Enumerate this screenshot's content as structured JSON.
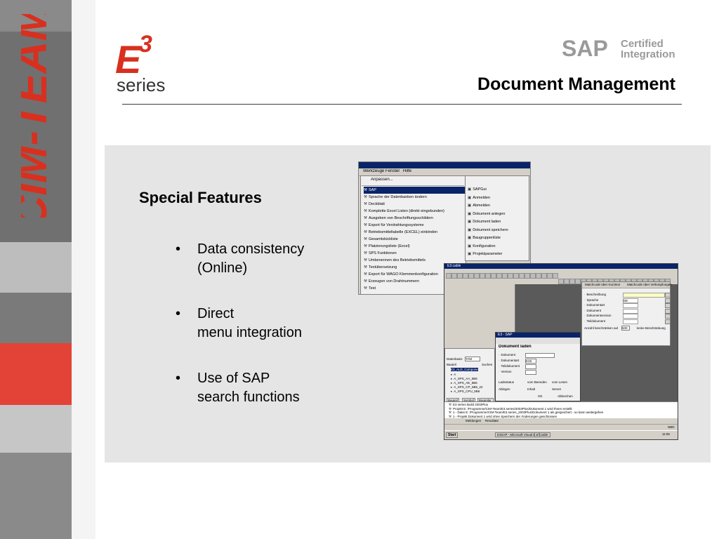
{
  "brand": {
    "sidebar_text": "CIM-TEAM",
    "logo_text": "series",
    "logo_mark": "E3",
    "sap_text": "SAP",
    "certified_line1": "Certified",
    "certified_line2": "Integration"
  },
  "header": {
    "title": "Document Management"
  },
  "features": {
    "heading": "Special Features",
    "items": [
      {
        "text": "Data consistency\n(Online)"
      },
      {
        "text": "Direct\nmenu integration"
      },
      {
        "text": "Use of SAP\nsearch functions"
      }
    ]
  },
  "screenshot1": {
    "menubar": [
      "Werkzeuge",
      "Fenster",
      "Hilfe"
    ],
    "first_item": "Anpassen...",
    "menu_items": [
      "SAP",
      "Sprache der Datenbanken ändern",
      "Deckblatt",
      "Komplette Excel Listen (direkt eingebunden)",
      "Ausgeben von Beschriftungsschildern",
      "Export für Verdrahtungssysteme",
      "Betriebsmitteltabelle (EXCEL) einbinden",
      "Gesamtstückliste",
      "Platzierungsliste (Excel)",
      "SPS Funktionen",
      "Umbenennen des Betriebsmittels",
      "Textübersetzung",
      "Export für WAGO Klemmenkonfiguration",
      "Erzeugen von Drahtnummern",
      "Test"
    ],
    "submenu_items": [
      "SAPGui",
      "Anmelden",
      "Abmelden",
      "Dokument anlegen",
      "Dokument laden",
      "Dokument speichern",
      "Baugruppenliste",
      "Konfiguration",
      "Projektparameter"
    ]
  },
  "screenshot2": {
    "window_title": "E3.cable",
    "dialog_title": "E3 - SAP",
    "dialog_heading": "Dokument laden",
    "fields": [
      "Dokument",
      "Dokumentart",
      "Teildokument",
      "Version"
    ],
    "doc_type_value": "E3S",
    "ladestatus_label": "Ladestatus",
    "ladestatus_options": [
      "vom Beenden",
      "vom Lesen"
    ],
    "ablegen_label": "Ablegen",
    "ablegen_options": [
      "Inhalt",
      "Server"
    ],
    "ok_label": "OK",
    "cancel_label": "Abbrechen",
    "tabs": [
      "Matchcode über Kurztext",
      "Matchcode über Verknüpfungen"
    ],
    "search_fields": [
      "Beschreibung",
      "Sprache",
      "Dokumentart",
      "Dokument",
      "Dokumentversion",
      "Teildokument"
    ],
    "search_lang_value": "DE",
    "max_hits_label": "Anzahl beschränken auf",
    "max_hits_value": "500",
    "no_limit_label": "keine Beschränkung",
    "taskbar_start": "Start",
    "taskbar_item1": "E3SAP - Microsoft Visual B...",
    "taskbar_item2": "E³.cable",
    "taskbar_time": "11:05",
    "status_lang": "NBD",
    "log_lines": [
      "E3 series Build 2003Plus",
      "Projekt E: /Programme/CIM-Team/E3.series/2003Plus/Dokument 1 wird Ihnen erstellt",
      "1 - Datei E: /Programme/CIM-Team/E3.series_2003Plus/Dokument 1 als gespeichert - so kann weitergehen",
      "1 - Projekt Dokument 1 wird ohne Speichern der Änderungen geschlossen"
    ],
    "bottom_tabs": [
      "Meldungen",
      "Resultate"
    ],
    "tree_panel_label": "Dokument",
    "tree_root": "E3_ALD_Compone",
    "tree_items": [
      "A",
      "A_SPS_AA_5B6",
      "A_SPS_AE_5B6",
      "A_SPS_CP_5B6_22",
      "A_SPS_CPU_5B6"
    ],
    "side_tabs": [
      "Bauteil",
      "Symbol",
      "Bauteilgr."
    ],
    "filter_label": "Bauteil",
    "search_label": "Suchen",
    "ds_label": "Datenbasis",
    "ds_value": "TAM"
  }
}
